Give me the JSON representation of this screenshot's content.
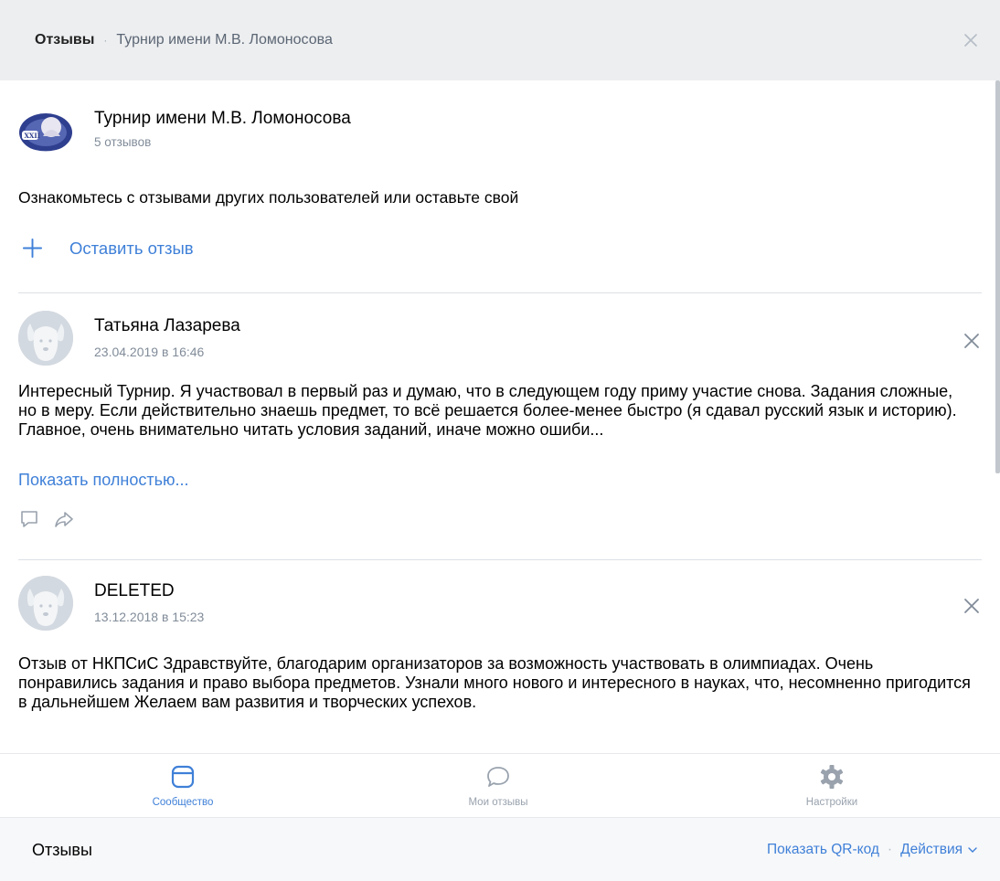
{
  "header": {
    "title": "Отзывы",
    "separator": "·",
    "subtitle": "Турнир имени М.В. Ломоносова",
    "close_icon": "close-icon"
  },
  "group": {
    "name": "Турнир имени М.В. Ломоносова",
    "review_count": "5 отзывов",
    "logo_icon": "tournament-logo"
  },
  "intro_text": "Ознакомьтесь с отзывами других пользователей или оставьте свой",
  "add_review": {
    "label": "Оставить отзыв",
    "icon": "plus-icon"
  },
  "reviews": [
    {
      "author": "Татьяна Лазарева",
      "date": "23.04.2019 в 16:46",
      "text": "Интересный Турнир. Я участвовал в первый раз и думаю, что в следующем году приму участие снова. Задания сложные, но в меру. Если действительно знаешь предмет, то всё решается более-менее быстро (я сдавал русский язык и историю). Главное, очень внимательно читать условия заданий, иначе можно ошиби...",
      "show_more": "Показать полностью..."
    },
    {
      "author": "DELETED",
      "date": "13.12.2018 в 15:23",
      "text": "Отзыв от НКПСиС Здравствуйте, благодарим организаторов за возможность участвовать в олимпиадах. Очень понравились задания и право выбора предметов. Узнали много нового и интересного в науках, что, несомненно пригодится в дальнейшем Желаем вам развития и творческих успехов."
    }
  ],
  "tabs": [
    {
      "label": "Сообщество",
      "icon": "community-icon",
      "active": true
    },
    {
      "label": "Мои отзывы",
      "icon": "speech-bubble-icon",
      "active": false
    },
    {
      "label": "Настройки",
      "icon": "gear-icon",
      "active": false
    }
  ],
  "footer": {
    "title": "Отзывы",
    "qr_label": "Показать QR-код",
    "separator": "·",
    "actions_label": "Действия"
  },
  "colors": {
    "accent": "#3f80d8",
    "header_bg": "#edeef0",
    "secondary_text": "#818c99",
    "tab_inactive": "#99a2ad"
  }
}
